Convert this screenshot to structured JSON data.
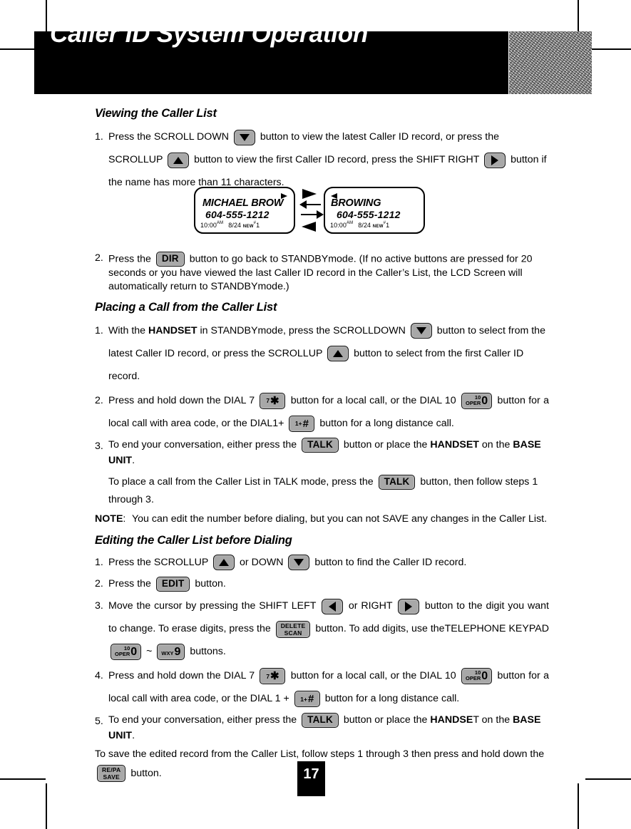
{
  "header": {
    "title": "Caller ID System Operation",
    "noise_swatch": "texture-square"
  },
  "page_number": "17",
  "sections": [
    {
      "id": "viewing",
      "heading": "Viewing the Caller List"
    },
    {
      "id": "placing",
      "heading": "Placing a Call from the Caller List"
    },
    {
      "id": "editing",
      "heading": "Editing the Caller List before Dialing"
    }
  ],
  "viewing": {
    "step1": {
      "num": "1.",
      "t1": "Press the SCROLL  DOWN",
      "t2": "button to view the latest Caller ID record, or press the",
      "t3": "SCROLLUP",
      "t4": "button to view the first Caller ID record, press the SHIFT RIGHT",
      "t5": "button if the name has more than 11 characters."
    },
    "step2": {
      "num": "2.",
      "t1": "Press the",
      "t2": "button to go back to STANDBYmode. (If no active buttons are pressed for 20 seconds or you have viewed the last Caller ID record in the Caller’s List, the LCD Screen will automatically return to STANDBYmode.)"
    }
  },
  "lcd": {
    "left": {
      "name": "MICHAEL BROW",
      "number": "604-555-1212",
      "time": "10:00",
      "ampm": "AM",
      "date": "8/24",
      "new_label": "NEW",
      "hash": "#",
      "count": "1",
      "corner_arrow": "right-triangle-icon"
    },
    "right": {
      "name": "BROWING",
      "number": "604-555-1212",
      "time": "10:00",
      "ampm": "AM",
      "date": "8/24",
      "new_label": "NEW",
      "hash": "#",
      "count": "1",
      "corner_arrow": "left-triangle-icon"
    }
  },
  "placing": {
    "step1": {
      "num": "1.",
      "t1": "With the",
      "b1": "HANDSET",
      "t2": "in STANDBYmode, press the SCROLLDOWN",
      "t3": "button to select from the latest Caller ID record, or press the SCROLLUP",
      "t4": "button to select from the first Caller ID record."
    },
    "step2": {
      "num": "2.",
      "t1": "Press and hold down the DIAL 7",
      "t2": "button for a local call, or the DIAL 10",
      "t3": "button for a local call with area code, or the DIAL1+",
      "t4": "button for a long distance call."
    },
    "step3": {
      "num": "3.",
      "t1": "To end your conversation, either press the",
      "t2": "button or place the",
      "b1": "HANDSET",
      "t3": "on the",
      "b2": "BASE UNIT",
      "t4": "."
    },
    "note_para": {
      "t1": "To place a call from the Caller List in TALK mode, press the",
      "t2": "button, then follow steps 1 through 3."
    },
    "note": {
      "label": "NOTE",
      "colon": ":",
      "text": "You can edit the number before dialing, but you can not SAVE any changes in the Caller List."
    }
  },
  "editing": {
    "step1": {
      "num": "1.",
      "t1": "Press  the  SCROLLUP",
      "t2": "or DOWN",
      "t3": "button to find the Caller ID record."
    },
    "step2": {
      "num": "2.",
      "t1": "Press the",
      "t2": "button."
    },
    "step3": {
      "num": "3.",
      "t1": "Move  the  cursor  by  pressing  the  SHIFT  LEFT",
      "t2": "or RIGHT",
      "t3": "button  to  the  digit you  want  to  change.  To  erase  digits,  press  the",
      "t4": "button.  To  add  digits,  use theTELEPHONE KEYPAD",
      "t5": "~",
      "t6": "buttons."
    },
    "step4": {
      "num": "4.",
      "t1": "Press and hold down the DIAL 7",
      "t2": "button for a local call, or the DIAL 10",
      "t3": "button for a local call with area code, or the DIAL 1 +",
      "t4": "button for a long distance call."
    },
    "step5": {
      "num": "5.",
      "t1": "To end your conversation, either press the",
      "t2": "button or place the",
      "b1": "HANDSE",
      "t3": "T on the",
      "b2": "BASE UNIT",
      "t4": "."
    },
    "save_para": {
      "t1": "To save the edited record from the Caller List, follow steps 1 through 3 then press and hold down the",
      "t2": "button."
    }
  },
  "buttons": {
    "scroll_down": {
      "name": "scroll-down-button",
      "glyph": "down-triangle-icon"
    },
    "scroll_up": {
      "name": "scroll-up-button",
      "glyph": "up-triangle-icon"
    },
    "shift_right": {
      "name": "shift-right-button",
      "glyph": "right-triangle-icon"
    },
    "shift_left": {
      "name": "shift-left-button",
      "glyph": "left-triangle-icon"
    },
    "dir": {
      "label": "DIR"
    },
    "talk": {
      "label": "TALK"
    },
    "edit": {
      "label": "EDIT"
    },
    "delete_scan": {
      "line1": "DELETE",
      "line2": "SCAN"
    },
    "repa_save": {
      "line1": "RE/PA",
      "line2": "SAVE"
    },
    "dial7": {
      "sup": "7",
      "glyph": "✱"
    },
    "dial10": {
      "sup": "10",
      "sub": "OPER",
      "digit": "0"
    },
    "dial1plus": {
      "sup": "1+",
      "glyph": "#"
    },
    "key9": {
      "letters": "WXY",
      "digit": "9"
    }
  }
}
